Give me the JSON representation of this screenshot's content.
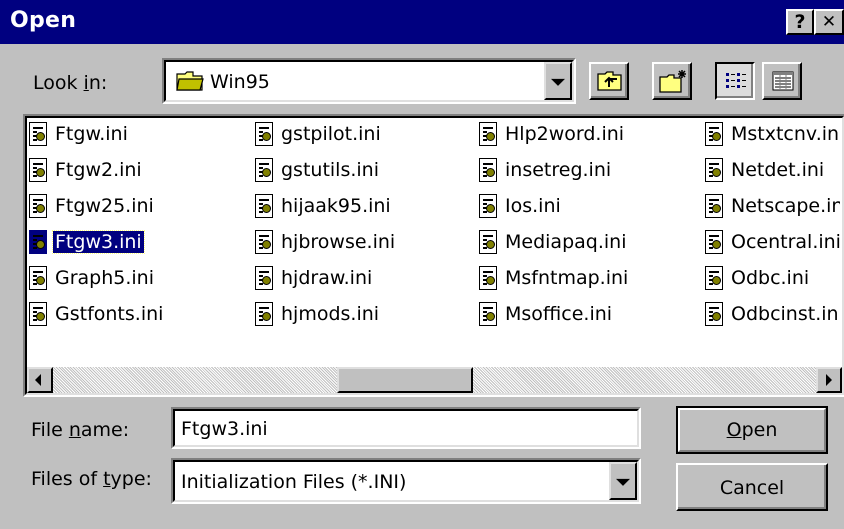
{
  "window": {
    "title": "Open",
    "help_glyph": "?",
    "close_glyph": "✕"
  },
  "look_in": {
    "label_pre": "Look ",
    "label_accel": "i",
    "label_post": "n:",
    "value": "Win95",
    "icon": "folder-icon"
  },
  "toolbar": {
    "up_one_level_icon": "up-folder-icon",
    "new_folder_icon": "new-folder-icon",
    "list_view_icon": "list-view-icon",
    "details_view_icon": "details-view-icon"
  },
  "files": {
    "columns": [
      [
        "Ftgw.ini",
        "Ftgw2.ini",
        "Ftgw25.ini",
        "Ftgw3.ini",
        "Graph5.ini",
        "Gstfonts.ini"
      ],
      [
        "gstpilot.ini",
        "gstutils.ini",
        "hijaak95.ini",
        "hjbrowse.ini",
        "hjdraw.ini",
        "hjmods.ini"
      ],
      [
        "Hlp2word.ini",
        "insetreg.ini",
        "Ios.ini",
        "Mediapaq.ini",
        "Msfntmap.ini",
        "Msoffice.ini"
      ],
      [
        "Mstxtcnv.ini",
        "Netdet.ini",
        "Netscape.ini",
        "Ocentral.ini",
        "Odbc.ini",
        "Odbcinst.ini"
      ]
    ],
    "selected": "Ftgw3.ini",
    "icon": "ini-file-icon"
  },
  "file_name": {
    "label_pre": "File ",
    "label_accel": "n",
    "label_post": "ame:",
    "value": "Ftgw3.ini"
  },
  "file_type": {
    "label_pre": "Files of ",
    "label_accel": "t",
    "label_post": "ype:",
    "value": "Initialization Files (*.INI)"
  },
  "buttons": {
    "open_accel": "O",
    "open_rest": "pen",
    "cancel": "Cancel"
  }
}
